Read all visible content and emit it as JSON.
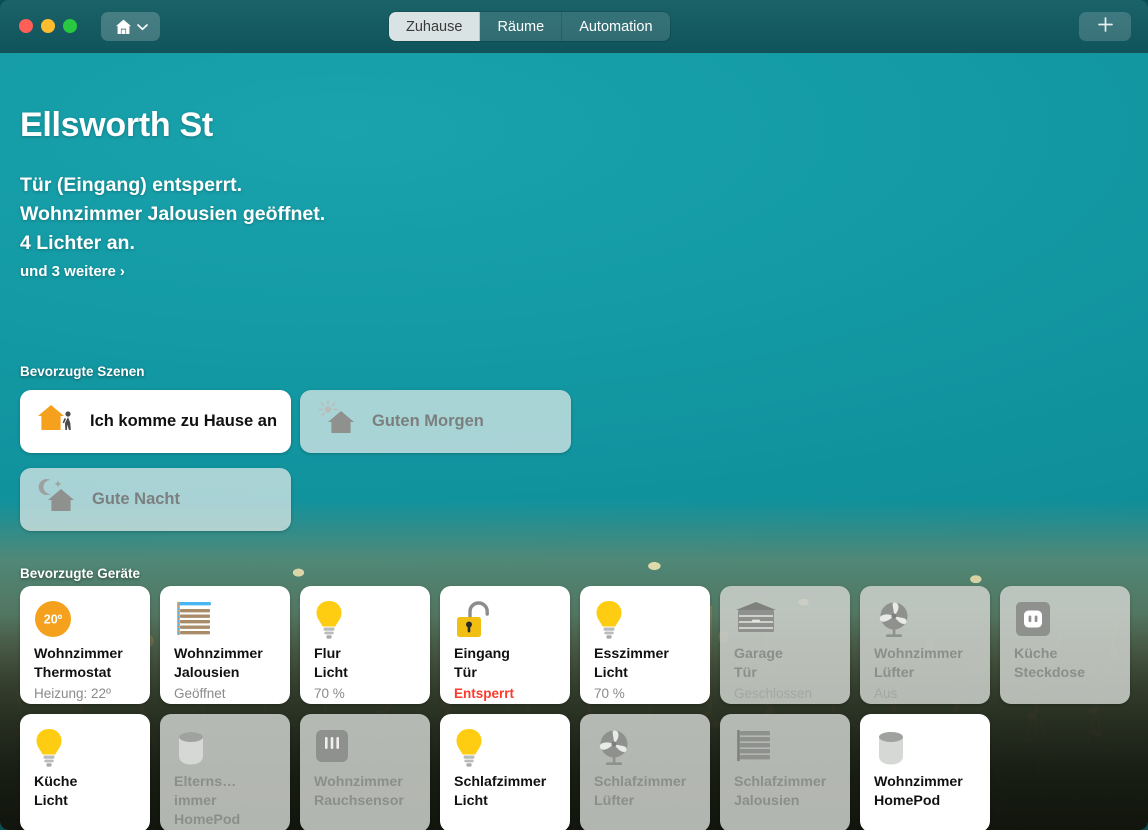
{
  "window": {
    "traffic_lights": [
      "close",
      "minimize",
      "zoom"
    ],
    "home_button": {
      "icon": "home-icon",
      "chevron": "chevron-down-icon"
    },
    "add_button_label": "+",
    "tabs": [
      {
        "label": "Zuhause",
        "active": true
      },
      {
        "label": "Räume",
        "active": false
      },
      {
        "label": "Automation",
        "active": false
      }
    ]
  },
  "home": {
    "title": "Ellsworth St",
    "status_lines": [
      "Tür (Eingang) entsperrt.",
      "Wohnzimmer Jalousien geöffnet.",
      "4 Lichter an."
    ],
    "more_link": "und 3 weitere",
    "more_chevron": "›"
  },
  "sections": {
    "scenes_label": "Bevorzugte Szenen",
    "devices_label": "Bevorzugte Geräte"
  },
  "scenes": [
    {
      "name": "Ich komme zu Hause an",
      "icon": "house-person-icon",
      "on": true
    },
    {
      "name": "Guten Morgen",
      "icon": "house-sun-icon",
      "on": false
    },
    {
      "name": "Gute Nacht",
      "icon": "house-moon-icon",
      "on": false
    }
  ],
  "devices": [
    {
      "name_line1": "Wohnzimmer",
      "name_line2": "Thermostat",
      "status": "Heizung: 22º",
      "icon": "thermostat-icon",
      "badge": "20º",
      "on": true,
      "alert": false
    },
    {
      "name_line1": "Wohnzimmer",
      "name_line2": "Jalousien",
      "status": "Geöffnet",
      "icon": "blinds-open-icon",
      "on": true,
      "alert": false
    },
    {
      "name_line1": "Flur",
      "name_line2": "Licht",
      "status": "70 %",
      "icon": "lightbulb-icon",
      "on": true,
      "alert": false
    },
    {
      "name_line1": "Eingang",
      "name_line2": "Tür",
      "status": "Entsperrt",
      "icon": "lock-open-icon",
      "on": true,
      "alert": true
    },
    {
      "name_line1": "Esszimmer",
      "name_line2": "Licht",
      "status": "70 %",
      "icon": "lightbulb-icon",
      "on": true,
      "alert": false
    },
    {
      "name_line1": "Garage",
      "name_line2": "Tür",
      "status": "Geschlossen",
      "icon": "garage-door-icon",
      "on": false,
      "alert": false
    },
    {
      "name_line1": "Wohnzimmer",
      "name_line2": "Lüfter",
      "status": "Aus",
      "icon": "fan-icon",
      "on": false,
      "alert": false
    },
    {
      "name_line1": "Küche",
      "name_line2": "Steckdose",
      "status": "",
      "icon": "outlet-icon",
      "on": false,
      "alert": false
    },
    {
      "name_line1": "Küche",
      "name_line2": "Licht",
      "status": "",
      "icon": "lightbulb-icon",
      "on": true,
      "alert": false
    },
    {
      "name_line1": "Elterns…immer",
      "name_line2": "HomePod",
      "status": "",
      "icon": "homepod-icon",
      "on": false,
      "alert": false
    },
    {
      "name_line1": "Wohnzimmer",
      "name_line2": "Rauchsensor",
      "status": "",
      "icon": "smoke-sensor-icon",
      "on": false,
      "alert": false
    },
    {
      "name_line1": "Schlafzimmer",
      "name_line2": "Licht",
      "status": "",
      "icon": "lightbulb-icon",
      "on": true,
      "alert": false
    },
    {
      "name_line1": "Schlafzimmer",
      "name_line2": "Lüfter",
      "status": "",
      "icon": "fan-icon",
      "on": false,
      "alert": false
    },
    {
      "name_line1": "Schlafzimmer",
      "name_line2": "Jalousien",
      "status": "",
      "icon": "blinds-closed-icon",
      "on": false,
      "alert": false
    },
    {
      "name_line1": "Wohnzimmer",
      "name_line2": "HomePod",
      "status": "",
      "icon": "homepod-icon",
      "on": true,
      "alert": false
    }
  ],
  "colors": {
    "wall_teal": "#159aa5",
    "titlebar": "#155a61",
    "accent_orange": "#f5a11e",
    "bulb_yellow": "#fecd12",
    "alert_red": "#fc3b2d",
    "tile_on": "#ffffff",
    "tile_off": "#cdd0cc",
    "tab_active_bg": "#d9e3e3"
  }
}
